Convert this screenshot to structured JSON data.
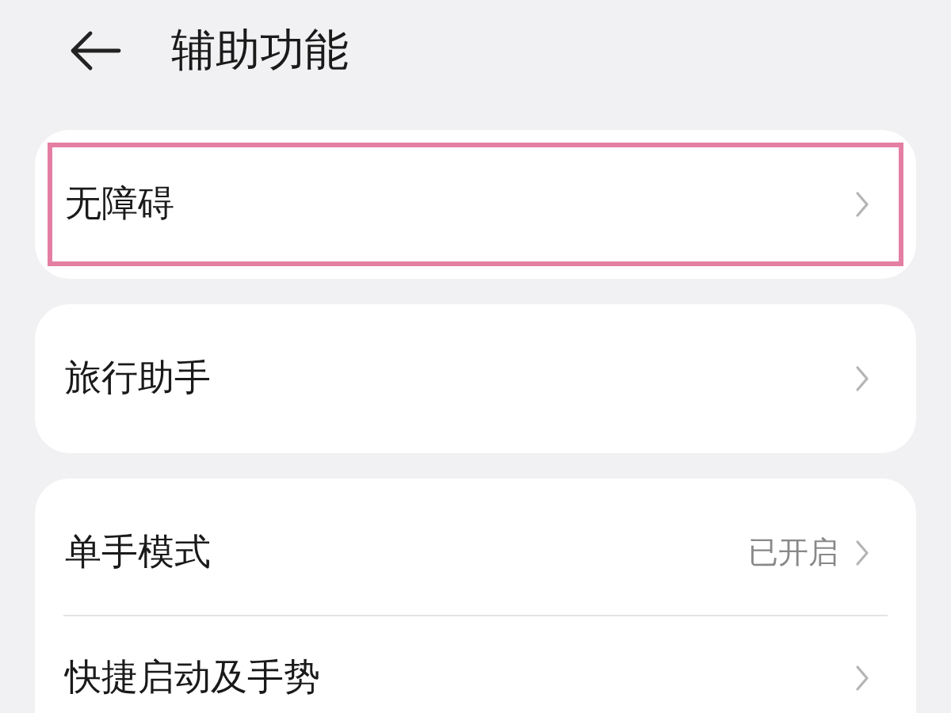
{
  "header": {
    "title": "辅助功能"
  },
  "cards": [
    {
      "rows": [
        {
          "label": "无障碍",
          "highlighted": true
        }
      ]
    },
    {
      "rows": [
        {
          "label": "旅行助手",
          "highlighted": false
        }
      ]
    },
    {
      "rows": [
        {
          "label": "单手模式",
          "value": "已开启",
          "highlighted": false
        },
        {
          "label": "快捷启动及手势",
          "highlighted": false
        }
      ]
    }
  ]
}
